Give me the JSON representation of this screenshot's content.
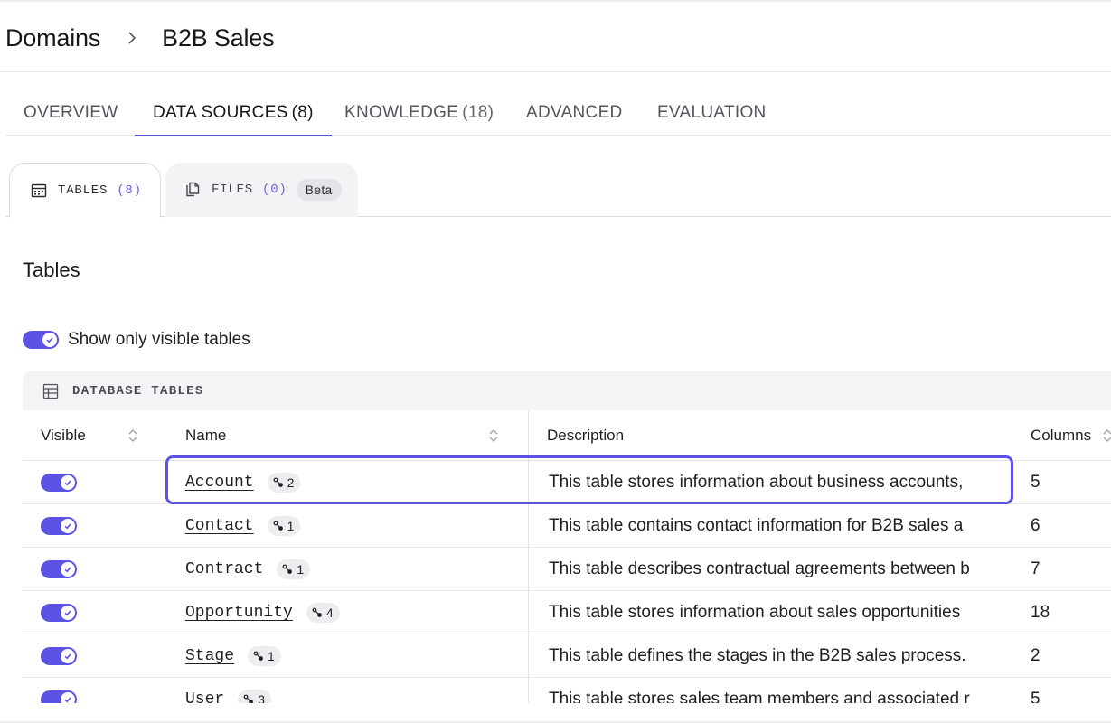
{
  "breadcrumb": {
    "parent": "Domains",
    "current": "B2B Sales"
  },
  "main_tabs": [
    {
      "label": "OVERVIEW",
      "count": ""
    },
    {
      "label": "DATA SOURCES",
      "count": "(8)"
    },
    {
      "label": "KNOWLEDGE",
      "count": "(18)"
    },
    {
      "label": "ADVANCED",
      "count": ""
    },
    {
      "label": "EVALUATION",
      "count": ""
    }
  ],
  "sub_tabs": {
    "tables": {
      "label": "TABLES",
      "count": "(8)",
      "icon": "table-icon"
    },
    "files": {
      "label": "FILES",
      "count": "(0)",
      "badge": "Beta",
      "icon": "files-icon"
    }
  },
  "section_title": "Tables",
  "visible_filter": {
    "label": "Show only visible tables",
    "enabled": true
  },
  "db_tables": {
    "header": "DATABASE TABLES",
    "columns": {
      "visible": "Visible",
      "name": "Name",
      "description": "Description",
      "columns": "Columns"
    },
    "rows": [
      {
        "visible": true,
        "name": "Account",
        "relations": "2",
        "description": "This table stores information about business accounts,",
        "columns": "5"
      },
      {
        "visible": true,
        "name": "Contact",
        "relations": "1",
        "description": "This table contains contact information for B2B sales a",
        "columns": "6"
      },
      {
        "visible": true,
        "name": "Contract",
        "relations": "1",
        "description": "This table describes contractual agreements between b",
        "columns": "7"
      },
      {
        "visible": true,
        "name": "Opportunity",
        "relations": "4",
        "description": "This table stores information about sales opportunities",
        "columns": "18"
      },
      {
        "visible": true,
        "name": "Stage",
        "relations": "1",
        "description": "This table defines the stages in the B2B sales process.",
        "columns": "2"
      },
      {
        "visible": true,
        "name": "User",
        "relations": "3",
        "description": "This table stores sales team members and associated r",
        "columns": "5"
      }
    ]
  },
  "colors": {
    "accent": "#5b53e6",
    "badge_bg": "#ededf0",
    "header_bg": "#f4f4f6"
  }
}
